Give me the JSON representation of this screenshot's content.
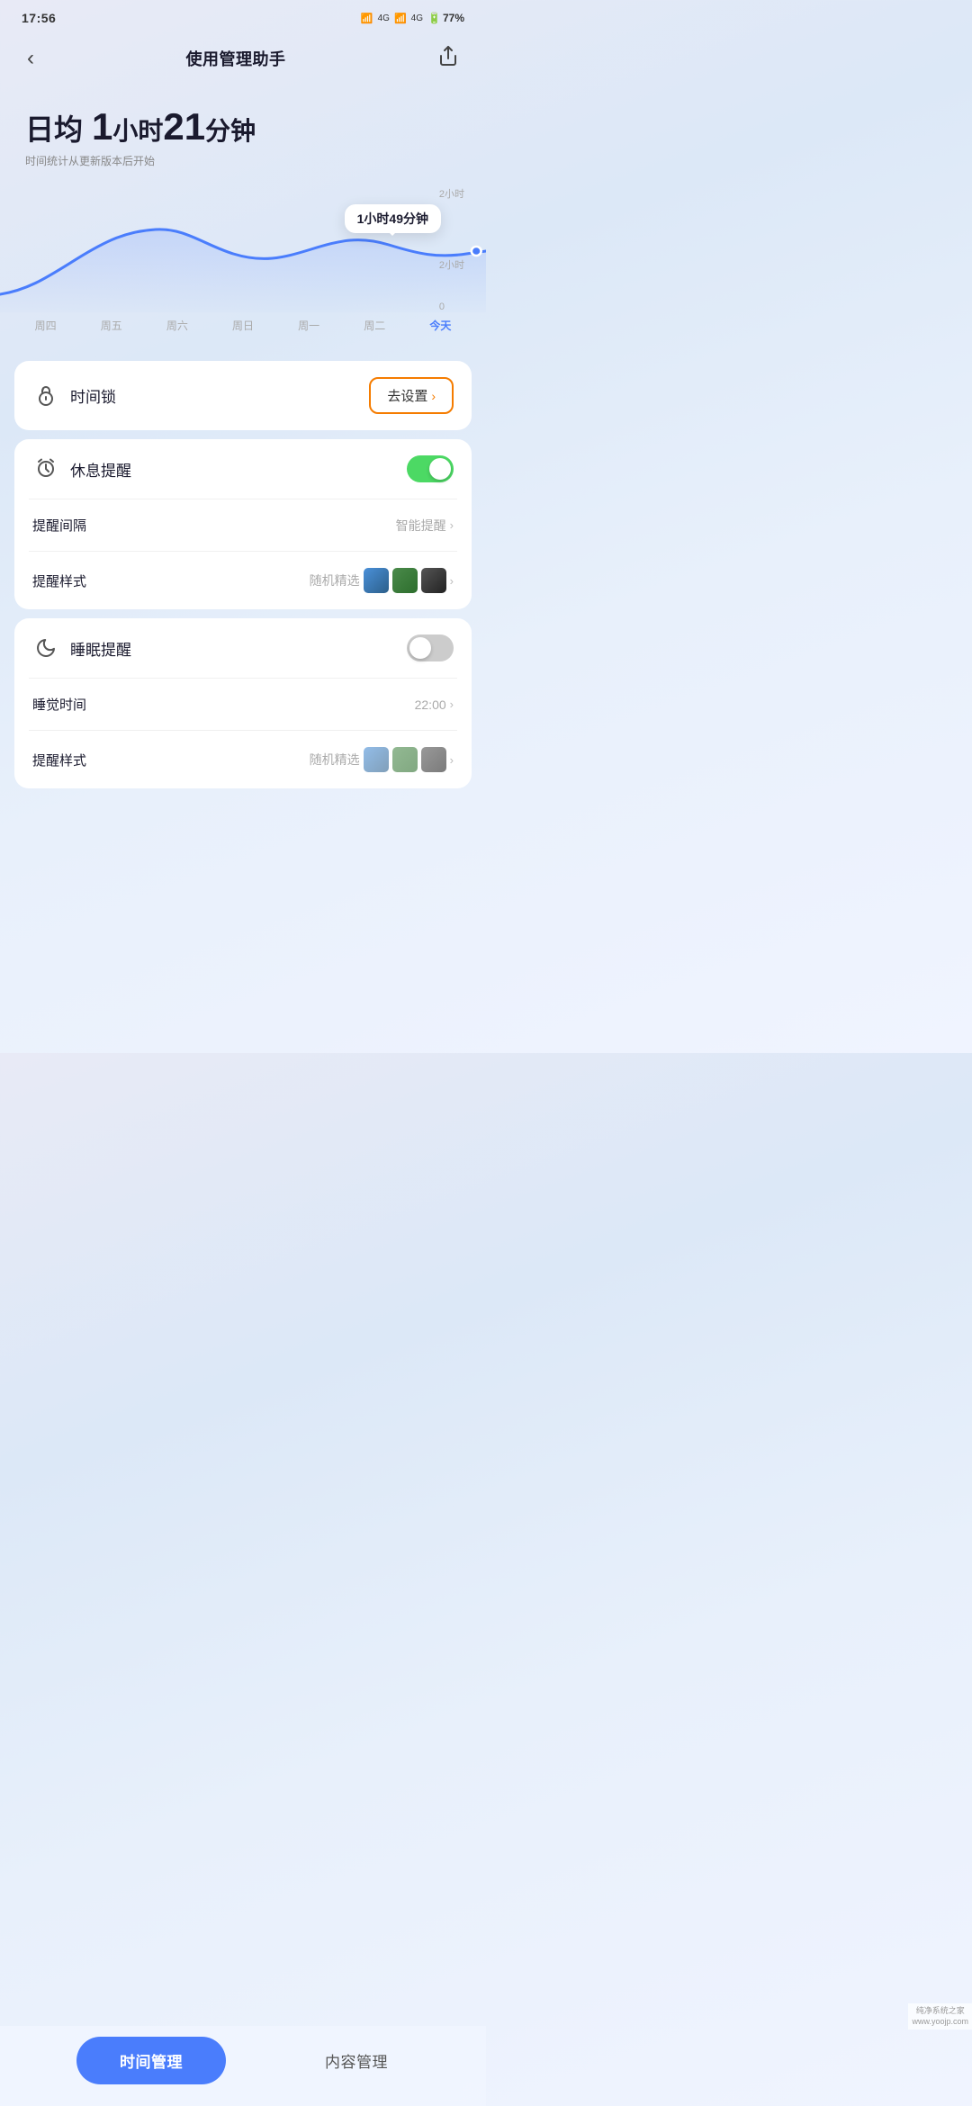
{
  "statusBar": {
    "time": "17:56",
    "battery": "77%"
  },
  "header": {
    "title": "使用管理助手",
    "backIcon": "‹",
    "shareIcon": "⎋"
  },
  "dailyStats": {
    "avgLabel": "日均",
    "avgTime": "1小时21分钟",
    "avgNum1": "1",
    "unit1": "小时",
    "avgNum2": "21",
    "unit2": "分钟",
    "note": "时间统计从更新版本后开始"
  },
  "chart": {
    "tooltipText": "1小时49分钟",
    "yLabels": [
      "2小时",
      "0"
    ],
    "xLabels": [
      "周四",
      "周五",
      "周六",
      "周日",
      "周一",
      "周二",
      "今天"
    ]
  },
  "timeLock": {
    "icon": "⏰",
    "label": "时间锁",
    "actionLabel": "去设置",
    "actionChevron": "›"
  },
  "restReminder": {
    "icon": "⏱",
    "label": "休息提醒",
    "toggleOn": true,
    "intervalLabel": "提醒间隔",
    "intervalValue": "智能提醒",
    "styleLabel": "提醒样式",
    "styleValue": "随机精选",
    "chevron": "›"
  },
  "sleepReminder": {
    "icon": "🌙",
    "label": "睡眠提醒",
    "toggleOn": false,
    "sleepTimeLabel": "睡觉时间",
    "sleepTimeValue": "22:00",
    "styleLabel": "提醒样式",
    "styleValue": "随机精选",
    "chevron": "›"
  },
  "bottomNav": {
    "timeManagement": "时间管理",
    "contentManagement": "内容管理"
  },
  "watermark": {
    "line1": "纯净系统之家",
    "line2": "www.yoojp.com"
  }
}
